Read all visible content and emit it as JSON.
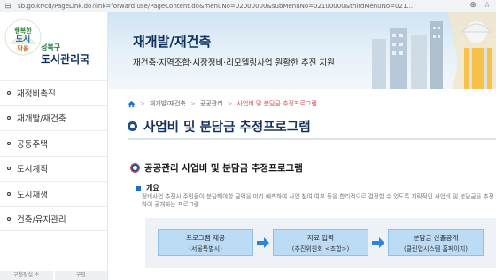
{
  "browser": {
    "url": "sb.go.kr/cd/PageLink.do?link=forward:use/PageContent.do&menuNo=02000000&subMenuNo=02100000&thirdMenuNo=021..."
  },
  "logo": {
    "badge_text": "행복ㅎ 도시",
    "org": "성북구",
    "title": "도시관리국"
  },
  "sidebar": {
    "items": [
      {
        "label": "재정비촉진"
      },
      {
        "label": "재개발/재건축"
      },
      {
        "label": "공동주택"
      },
      {
        "label": "도시계획"
      },
      {
        "label": "도시재생"
      },
      {
        "label": "건축/유지관리"
      }
    ],
    "bottom_tabs": [
      "구청장실 소",
      "구민"
    ]
  },
  "banner": {
    "title": "재개발/재건축",
    "subtitle": "재건축·지역조합·시장정비·리모델링사업 원활한 추진 지원"
  },
  "breadcrumb": {
    "items": [
      "재개발/재건축",
      "공공관리"
    ],
    "current": "사업비 및 분담금 추정프로그램"
  },
  "page": {
    "title": "사업비 및 분담금 추정프로그램"
  },
  "section": {
    "title": "공공관리 사업비 및 분담금 추정프로그램"
  },
  "overview": {
    "label": "개요",
    "text": "정비사업 추진시 주민들이 분담해야할 금액을 미리 예측하여 사업 참여 여부 등을 합리적으로 결정할 수 있도록 개략적인 사업비 및 분담금을 추정하여 공개하는 프로그램"
  },
  "flow": {
    "steps": [
      {
        "line1": "프로그램 제공",
        "line2": "(서울특별시)"
      },
      {
        "line1": "자료 입력",
        "line2": "(추진위원회 <조합>)"
      },
      {
        "line1": "분담금 산출공개",
        "line2": "(클린업시스템 홈페이지)"
      }
    ]
  },
  "colors": {
    "nav_text": "#333333",
    "title_navy": "#14325c",
    "breadcrumb_current": "#d9534f",
    "flow_box": "#bcdcf5",
    "arrow_blue": "#2a86d8"
  }
}
